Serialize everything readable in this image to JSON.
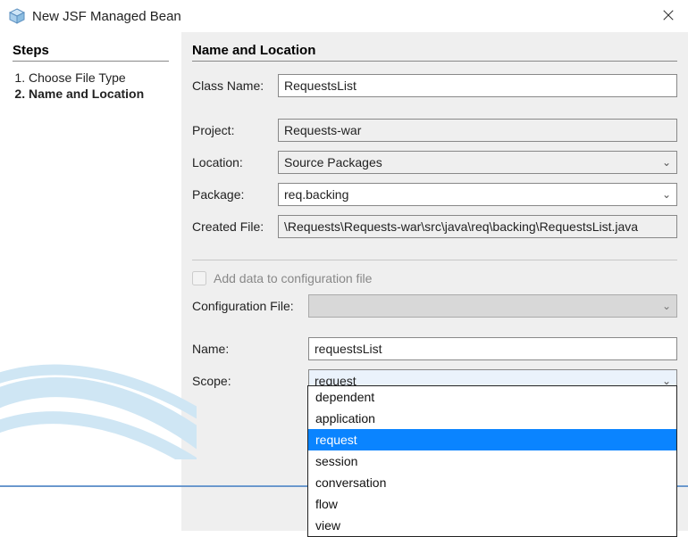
{
  "titlebar": {
    "title": "New JSF Managed Bean"
  },
  "sidebar": {
    "heading": "Steps",
    "steps": [
      {
        "label": "Choose File Type",
        "active": false
      },
      {
        "label": "Name and Location",
        "active": true
      }
    ]
  },
  "form": {
    "heading": "Name and Location",
    "labels": {
      "className": "Class Name:",
      "project": "Project:",
      "location": "Location:",
      "package": "Package:",
      "createdFile": "Created File:",
      "addConfig": "Add data to configuration file",
      "configFile": "Configuration File:",
      "name": "Name:",
      "scope": "Scope:"
    },
    "values": {
      "className": "RequestsList",
      "project": "Requests-war",
      "location": "Source Packages",
      "package": "req.backing",
      "createdFile": "\\Requests\\Requests-war\\src\\java\\req\\backing\\RequestsList.java",
      "configFile": "",
      "name": "requestsList",
      "scope": "request"
    },
    "scopeOptions": [
      "dependent",
      "application",
      "request",
      "session",
      "conversation",
      "flow",
      "view"
    ],
    "scopeSelected": "request"
  }
}
